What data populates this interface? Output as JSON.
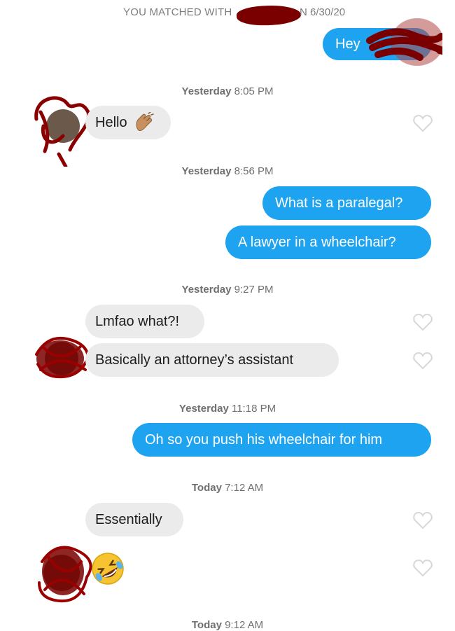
{
  "header": {
    "matched_text": "YOU MATCHED WITH",
    "matched_date": "N 6/30/20"
  },
  "messages": {
    "hey": "Hey",
    "hello": "Hello",
    "paralegal_q": "What is a paralegal?",
    "lawyer_q": "A lawyer in a wheelchair?",
    "lmfao": "Lmfao what?!",
    "assistant": "Basically an attorney’s assistant",
    "push": "Oh so you push his wheelchair for him",
    "essentially": "Essentially"
  },
  "timestamps": [
    {
      "day": "Yesterday",
      "time": "8:05 PM"
    },
    {
      "day": "Yesterday",
      "time": "8:56 PM"
    },
    {
      "day": "Yesterday",
      "time": "9:27 PM"
    },
    {
      "day": "Yesterday",
      "time": "11:18 PM"
    },
    {
      "day": "Today",
      "time": "7:12 AM"
    },
    {
      "day": "Today",
      "time": "9:12 AM"
    }
  ],
  "emojis": {
    "wave": "waving-hand",
    "laugh": "rolling-on-floor-laughing"
  },
  "colors": {
    "outgoing_bubble": "#1ea3f0",
    "incoming_bubble": "#ebebeb",
    "redaction": "#7a0000"
  }
}
